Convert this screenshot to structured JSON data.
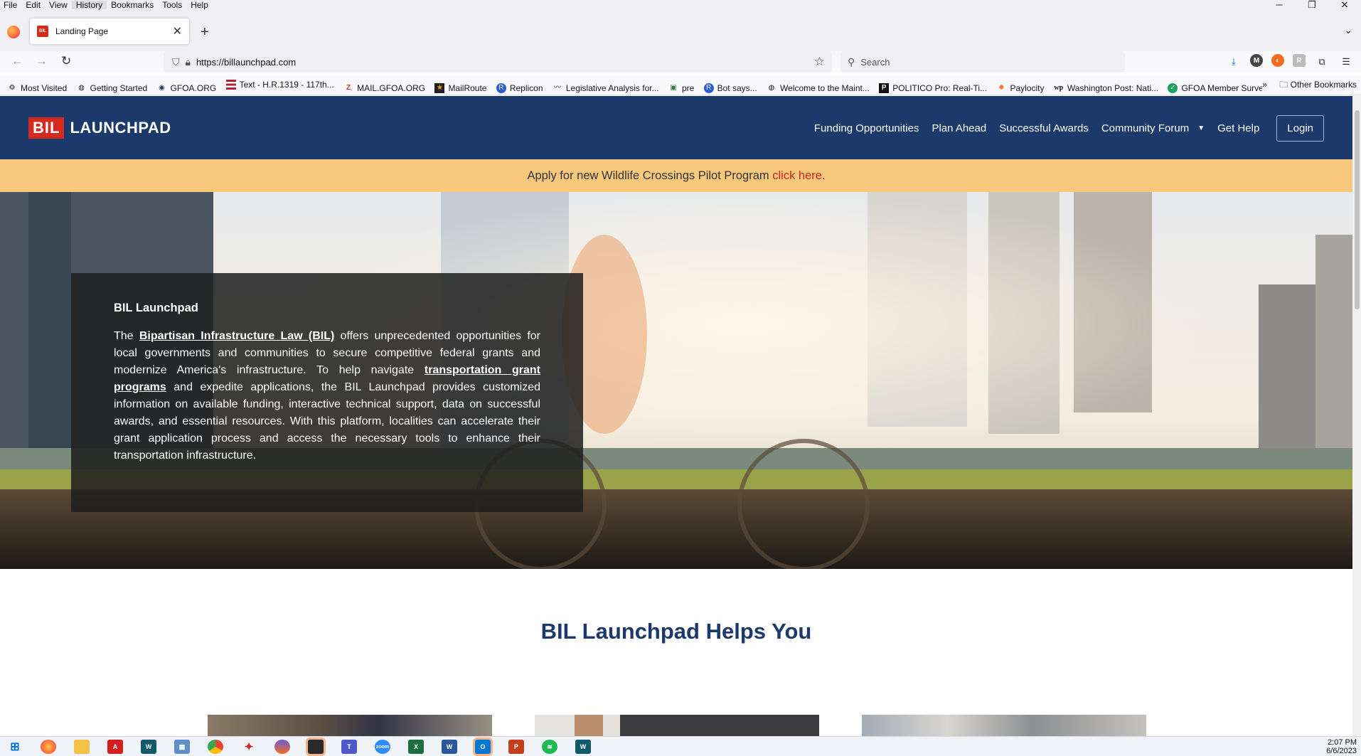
{
  "browser": {
    "menu": [
      "File",
      "Edit",
      "View",
      "History",
      "Bookmarks",
      "Tools",
      "Help"
    ],
    "tab_title": "Landing Page",
    "tab_favicon": "BIL",
    "url": "https://billaunchpad.com",
    "search_placeholder": "Search",
    "bookmarks": [
      {
        "label": "Most Visited",
        "icon": "gear-icon"
      },
      {
        "label": "Getting Started",
        "icon": "globe-icon"
      },
      {
        "label": "GFOA.ORG",
        "icon": "gfoa-icon"
      },
      {
        "label": "Text - H.R.1319 - 117th...",
        "icon": "flag-icon"
      },
      {
        "label": "MAIL.GFOA.ORG",
        "icon": "mail-icon"
      },
      {
        "label": "MailRoute",
        "icon": "mailroute-icon"
      },
      {
        "label": "Replicon",
        "icon": "replicon-icon"
      },
      {
        "label": "Legislative Analysis for...",
        "icon": "legislative-icon"
      },
      {
        "label": "pre",
        "icon": "page-icon"
      },
      {
        "label": "Bot says...",
        "icon": "bot-icon"
      },
      {
        "label": "Welcome to the Maint...",
        "icon": "globe-icon"
      },
      {
        "label": "POLITICO Pro: Real-Ti...",
        "icon": "politico-icon"
      },
      {
        "label": "Paylocity",
        "icon": "paylocity-icon"
      },
      {
        "label": "Washington Post: Nati...",
        "icon": "wapo-icon"
      },
      {
        "label": "GFOA Member Survey...",
        "icon": "survey-icon"
      }
    ],
    "other_bookmarks": "Other Bookmarks"
  },
  "site": {
    "logo_box": "BIL",
    "logo_text": "LAUNCHPAD",
    "nav": [
      "Funding Opportunities",
      "Plan Ahead",
      "Successful Awards",
      "Community Forum",
      "Get Help"
    ],
    "login": "Login",
    "banner_text": "Apply for new Wildlife Crossings Pilot Program ",
    "banner_link": "click here",
    "banner_end": "."
  },
  "hero": {
    "title": "BIL Launchpad",
    "p1": "The ",
    "link1": "Bipartisan Infrastructure Law (BIL)",
    "p2": " offers unprecedented opportunities for local governments and communities to secure competitive federal grants and modernize America's infrastructure. To help navigate ",
    "link2": "transportation grant programs",
    "p3": " and expedite applications, the BIL Launchpad provides customized information on available funding, interactive technical support, data on successful awards, and essential resources. With this platform, localities can accelerate their grant application process and access the necessary tools to enhance their transportation infrastructure."
  },
  "section": {
    "title": "BIL Launchpad Helps You"
  },
  "taskbar": {
    "time": "2:07 PM",
    "date": "6/6/2023"
  },
  "colors": {
    "header": "#1b3a6b",
    "banner": "#f8c87c",
    "brand_red": "#d52b1e"
  }
}
